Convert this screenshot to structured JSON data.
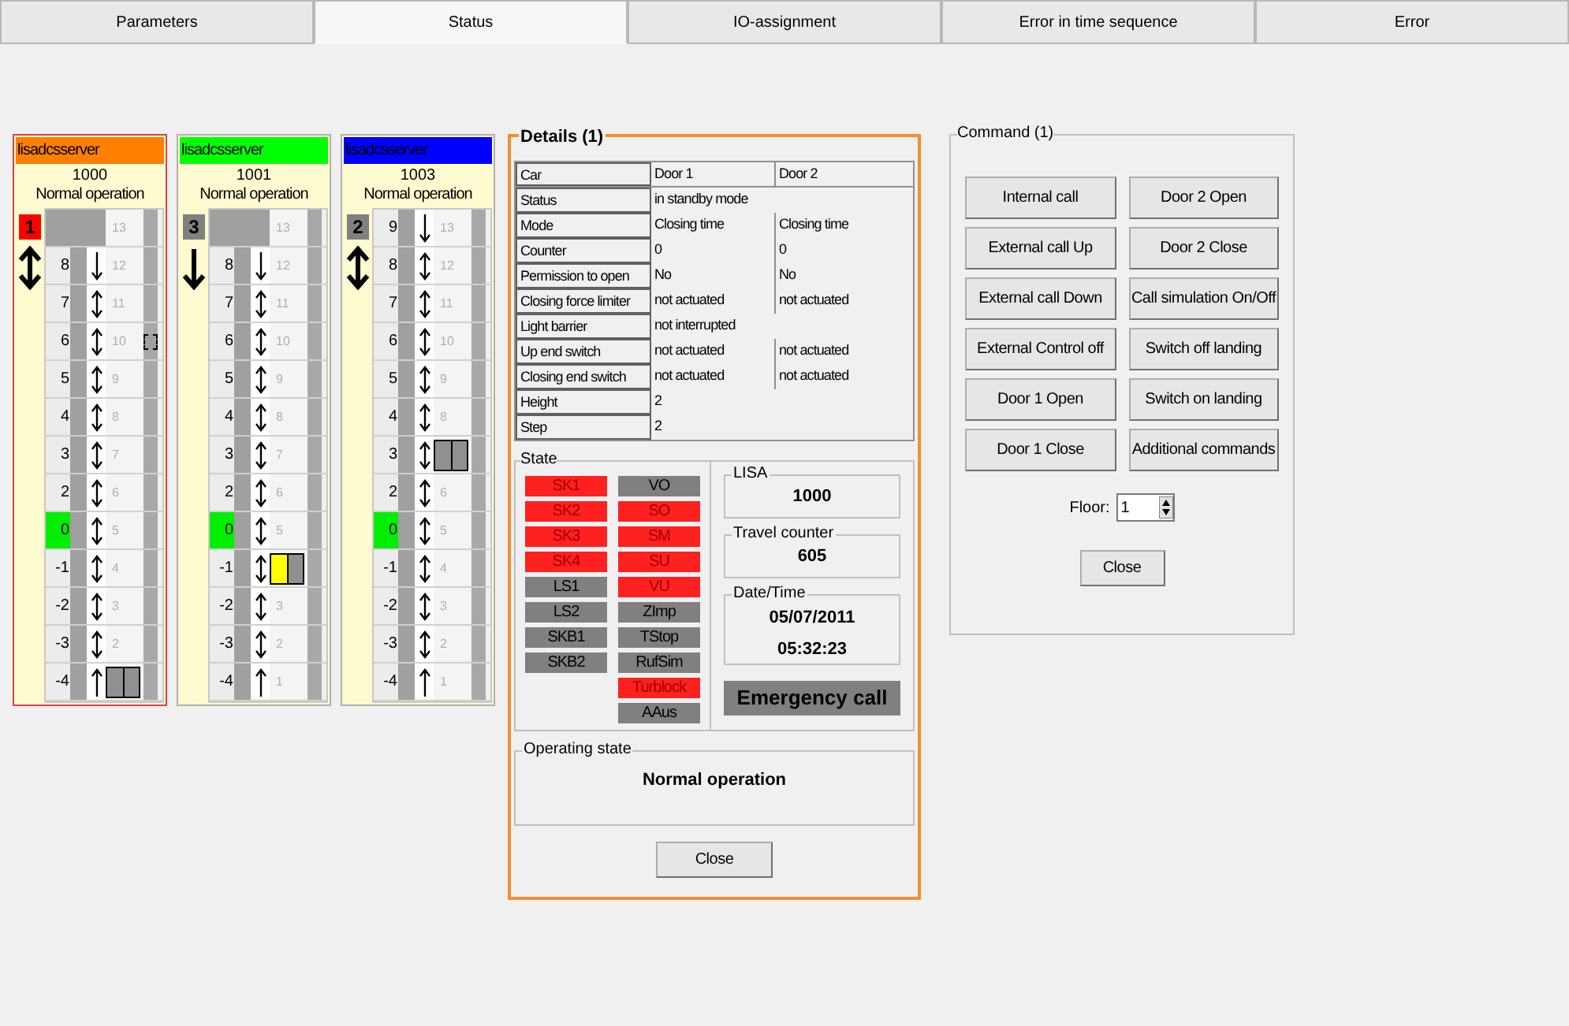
{
  "tabs": [
    {
      "label": "Parameters",
      "selected": false
    },
    {
      "label": "Status",
      "selected": true
    },
    {
      "label": "IO-assignment",
      "selected": false
    },
    {
      "label": "Error in time sequence",
      "selected": false
    },
    {
      "label": "Error",
      "selected": false
    }
  ],
  "elevators": [
    {
      "server": "lisadcsserver",
      "color": "#ff8000",
      "selected": true,
      "id": "1000",
      "status": "Normal operation",
      "badge": {
        "label": "1",
        "color": "#ff0000"
      },
      "dir_up": true,
      "dir_down": true,
      "car_lit": false,
      "rows": [
        {
          "up": false,
          "down": false,
          "index": "13",
          "current": false,
          "car": false,
          "call": false
        },
        {
          "floor": "8",
          "up": false,
          "down": true,
          "index": "12",
          "current": false,
          "car": false,
          "call": false
        },
        {
          "floor": "7",
          "up": true,
          "down": true,
          "index": "11",
          "current": false,
          "car": false,
          "call": false
        },
        {
          "floor": "6",
          "up": true,
          "down": true,
          "index": "10",
          "current": false,
          "car": false,
          "call": true
        },
        {
          "floor": "5",
          "up": true,
          "down": true,
          "index": "9",
          "current": false,
          "car": false,
          "call": false
        },
        {
          "floor": "4",
          "up": true,
          "down": true,
          "index": "8",
          "current": false,
          "car": false,
          "call": false
        },
        {
          "floor": "3",
          "up": true,
          "down": true,
          "index": "7",
          "current": false,
          "car": false,
          "call": false
        },
        {
          "floor": "2",
          "up": true,
          "down": true,
          "index": "6",
          "current": false,
          "car": false,
          "call": false
        },
        {
          "floor": "0",
          "up": true,
          "down": true,
          "index": "5",
          "current": true,
          "car": false,
          "call": false
        },
        {
          "floor": "-1",
          "up": true,
          "down": true,
          "index": "4",
          "current": false,
          "car": false,
          "call": false
        },
        {
          "floor": "-2",
          "up": true,
          "down": true,
          "index": "3",
          "current": false,
          "car": false,
          "call": false
        },
        {
          "floor": "-3",
          "up": true,
          "down": true,
          "index": "2",
          "current": false,
          "car": false,
          "call": false
        },
        {
          "floor": "-4",
          "up": true,
          "down": false,
          "current": false,
          "car": true,
          "call": false
        }
      ]
    },
    {
      "server": "lisadcsserver",
      "color": "#00ff00",
      "selected": false,
      "id": "1001",
      "status": "Normal operation",
      "badge": {
        "label": "3",
        "color": "#808080"
      },
      "dir_up": false,
      "dir_down": true,
      "car_lit": true,
      "rows": [
        {
          "up": false,
          "down": false,
          "index": "13",
          "current": false,
          "car": false,
          "call": false
        },
        {
          "floor": "8",
          "up": false,
          "down": true,
          "index": "12",
          "current": false,
          "car": false,
          "call": false
        },
        {
          "floor": "7",
          "up": true,
          "down": true,
          "index": "11",
          "current": false,
          "car": false,
          "call": false
        },
        {
          "floor": "6",
          "up": true,
          "down": true,
          "index": "10",
          "current": false,
          "car": false,
          "call": false
        },
        {
          "floor": "5",
          "up": true,
          "down": true,
          "index": "9",
          "current": false,
          "car": false,
          "call": false
        },
        {
          "floor": "4",
          "up": true,
          "down": true,
          "index": "8",
          "current": false,
          "car": false,
          "call": false
        },
        {
          "floor": "3",
          "up": true,
          "down": true,
          "index": "7",
          "current": false,
          "car": false,
          "call": false
        },
        {
          "floor": "2",
          "up": true,
          "down": true,
          "index": "6",
          "current": false,
          "car": false,
          "call": false
        },
        {
          "floor": "0",
          "up": true,
          "down": true,
          "index": "5",
          "current": true,
          "car": false,
          "call": false
        },
        {
          "floor": "-1",
          "up": true,
          "down": true,
          "current": false,
          "car": true,
          "call": false
        },
        {
          "floor": "-2",
          "up": true,
          "down": true,
          "index": "3",
          "current": false,
          "car": false,
          "call": false
        },
        {
          "floor": "-3",
          "up": true,
          "down": true,
          "index": "2",
          "current": false,
          "car": false,
          "call": false
        },
        {
          "floor": "-4",
          "up": true,
          "down": false,
          "index": "1",
          "current": false,
          "car": false,
          "call": false
        }
      ]
    },
    {
      "server": "lisadcsserver",
      "color": "#0000ff",
      "selected": false,
      "id": "1003",
      "status": "Normal operation",
      "badge": {
        "label": "2",
        "color": "#808080"
      },
      "dir_up": true,
      "dir_down": true,
      "car_lit": false,
      "rows": [
        {
          "floor": "9",
          "up": false,
          "down": true,
          "index": "13",
          "current": false,
          "car": false,
          "call": false
        },
        {
          "floor": "8",
          "up": true,
          "down": true,
          "index": "12",
          "current": false,
          "car": false,
          "call": false
        },
        {
          "floor": "7",
          "up": true,
          "down": true,
          "index": "11",
          "current": false,
          "car": false,
          "call": false
        },
        {
          "floor": "6",
          "up": true,
          "down": true,
          "index": "10",
          "current": false,
          "car": false,
          "call": false
        },
        {
          "floor": "5",
          "up": true,
          "down": true,
          "index": "9",
          "current": false,
          "car": false,
          "call": false
        },
        {
          "floor": "4",
          "up": true,
          "down": true,
          "index": "8",
          "current": false,
          "car": false,
          "call": false
        },
        {
          "floor": "3",
          "up": true,
          "down": true,
          "current": false,
          "car": true,
          "call": false
        },
        {
          "floor": "2",
          "up": true,
          "down": true,
          "index": "6",
          "current": false,
          "car": false,
          "call": false
        },
        {
          "floor": "0",
          "up": true,
          "down": true,
          "index": "5",
          "current": true,
          "car": false,
          "call": false
        },
        {
          "floor": "-1",
          "up": true,
          "down": true,
          "index": "4",
          "current": false,
          "car": false,
          "call": false
        },
        {
          "floor": "-2",
          "up": true,
          "down": true,
          "index": "3",
          "current": false,
          "car": false,
          "call": false
        },
        {
          "floor": "-3",
          "up": true,
          "down": true,
          "index": "2",
          "current": false,
          "car": false,
          "call": false
        },
        {
          "floor": "-4",
          "up": true,
          "down": false,
          "index": "1",
          "current": false,
          "car": false,
          "call": false
        }
      ]
    }
  ],
  "details": {
    "title": "Details (1)",
    "table": [
      [
        "Car",
        "Door 1",
        "Door 2"
      ],
      [
        "Status",
        "in standby mode"
      ],
      [
        "Mode",
        "Closing time",
        "Closing time"
      ],
      [
        "Counter",
        "0",
        "0"
      ],
      [
        "Permission to open",
        "No",
        "No"
      ],
      [
        "Closing force limiter",
        "not actuated",
        "not actuated"
      ],
      [
        "Light barrier",
        "not interrupted"
      ],
      [
        "Up end switch",
        "not actuated",
        "not actuated"
      ],
      [
        "Closing end switch",
        "not actuated",
        "not actuated"
      ],
      [
        "Height",
        "2"
      ],
      [
        "Step",
        "2"
      ]
    ],
    "state": {
      "label": "State",
      "columns": [
        [
          {
            "label": "SK1",
            "on": true
          },
          {
            "label": "SK2",
            "on": true
          },
          {
            "label": "SK3",
            "on": true
          },
          {
            "label": "SK4",
            "on": true
          },
          {
            "label": "LS1",
            "on": false
          },
          {
            "label": "LS2",
            "on": false
          },
          {
            "label": "SKB1",
            "on": false
          },
          {
            "label": "SKB2",
            "on": false
          }
        ],
        [
          {
            "label": "VO",
            "on": false
          },
          {
            "label": "SO",
            "on": true
          },
          {
            "label": "SM",
            "on": true
          },
          {
            "label": "SU",
            "on": true
          },
          {
            "label": "VU",
            "on": true
          },
          {
            "label": "ZImp",
            "on": false
          },
          {
            "label": "TStop",
            "on": false
          },
          {
            "label": "RufSim",
            "on": false
          },
          {
            "label": "Turblock",
            "on": true
          },
          {
            "label": "AAus",
            "on": false
          }
        ]
      ]
    },
    "lisa": {
      "label": "LISA",
      "value": "1000"
    },
    "travel_counter": {
      "label": "Travel counter",
      "value": "605"
    },
    "date_time": {
      "label": "Date/Time",
      "date": "05/07/2011",
      "time": "05:32:23"
    },
    "emergency_call": "Emergency call",
    "operating_state": {
      "label": "Operating state",
      "value": "Normal operation"
    },
    "close": "Close"
  },
  "command": {
    "title": "Command (1)",
    "buttons": [
      "Internal call",
      "Door 2 Open",
      "External call Up",
      "Door 2 Close",
      "External call Down",
      "Call simulation On/Off",
      "External Control off",
      "Switch off landing",
      "Door 1 Open",
      "Switch on landing",
      "Door 1 Close",
      "Additional commands"
    ],
    "floor_label": "Floor:",
    "floor_value": "1",
    "close": "Close"
  }
}
